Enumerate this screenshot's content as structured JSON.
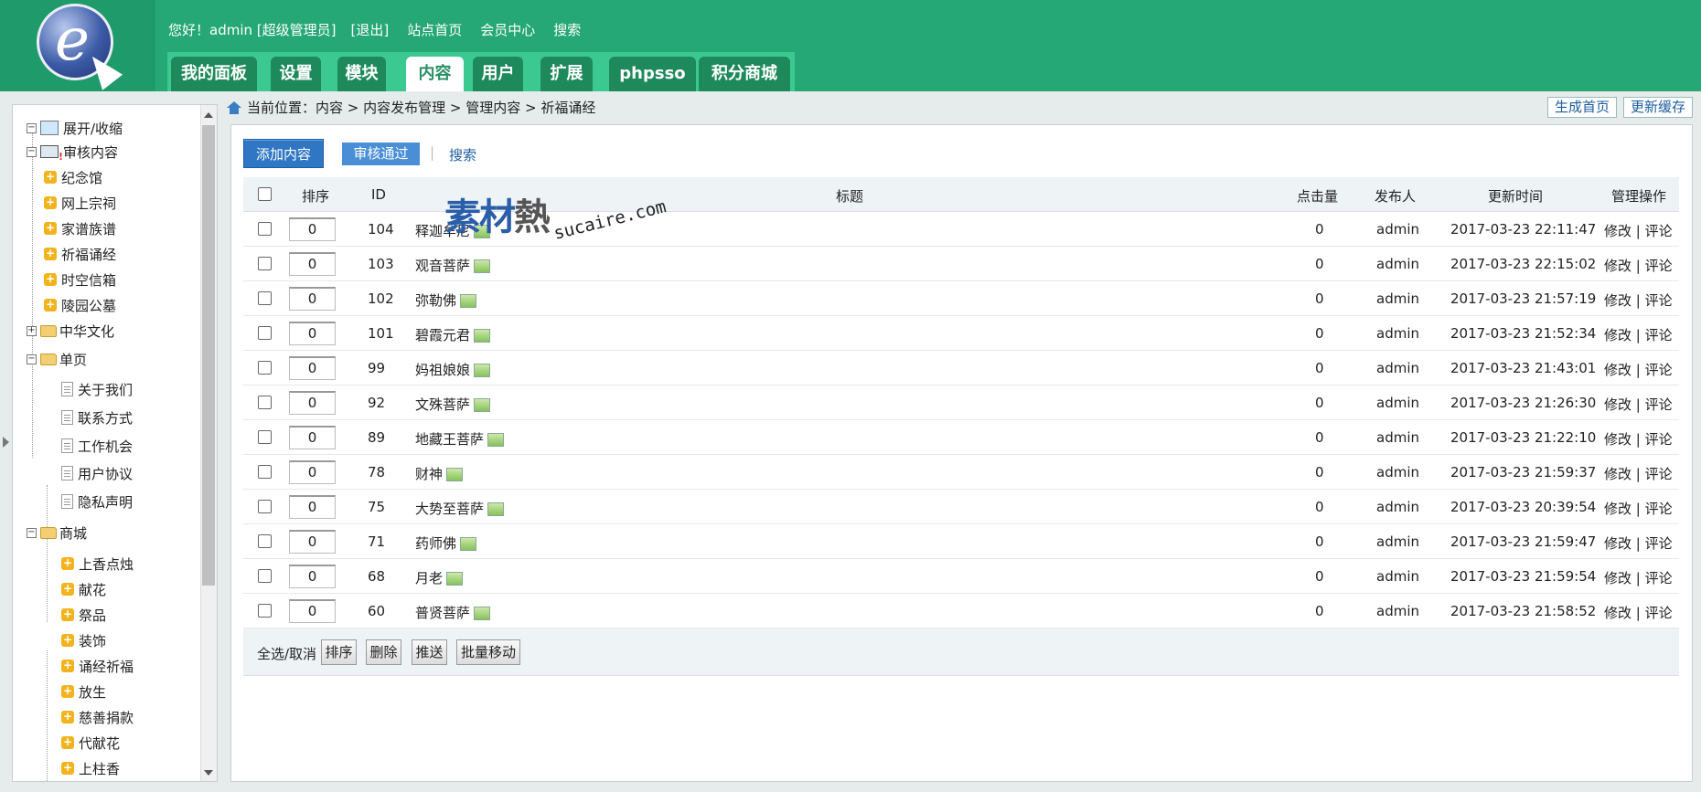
{
  "header": {
    "greeting": "您好！admin [超级管理员]",
    "logout": "[退出]",
    "site_home": "站点首页",
    "member_center": "会员中心",
    "search": "搜索",
    "logo_letter": "e",
    "tabs": [
      {
        "label": "我的面板"
      },
      {
        "label": "设置"
      },
      {
        "label": "模块"
      },
      {
        "label": "内容"
      },
      {
        "label": "用户"
      },
      {
        "label": "扩展"
      },
      {
        "label": "phpsso"
      },
      {
        "label": "积分商城"
      }
    ]
  },
  "sidebar": {
    "expand_collapse": "展开/收缩",
    "audit": "审核内容",
    "audit_children": [
      "纪念馆",
      "网上宗祠",
      "家谱族谱",
      "祈福诵经",
      "时空信箱",
      "陵园公墓"
    ],
    "culture": "中华文化",
    "single_page": "单页",
    "single_children": [
      "关于我们",
      "联系方式",
      "工作机会",
      "用户协议",
      "隐私声明"
    ],
    "mall": "商城",
    "mall_children": [
      "上香点烛",
      "献花",
      "祭品",
      "装饰",
      "诵经祈福",
      "放生",
      "慈善捐款",
      "代献花",
      "上柱香"
    ]
  },
  "breadcrumb": {
    "text": "当前位置：内容 > 内容发布管理 > 管理内容 > 祈福诵经"
  },
  "top_buttons": {
    "generate_home": "生成首页",
    "update_cache": "更新缓存"
  },
  "toolbar": {
    "add": "添加内容",
    "approve": "审核通过",
    "separator": "|",
    "search": "搜索"
  },
  "table": {
    "headers": {
      "order": "排序",
      "id": "ID",
      "title": "标题",
      "hits": "点击量",
      "publisher": "发布人",
      "updated": "更新时间",
      "ops": "管理操作"
    },
    "rows": [
      {
        "order": "0",
        "id": "104",
        "title": "释迦牟尼",
        "hits": "0",
        "publisher": "admin",
        "updated": "2017-03-23 22:11:47",
        "edit": "修改",
        "comment": "评论"
      },
      {
        "order": "0",
        "id": "103",
        "title": "观音菩萨",
        "hits": "0",
        "publisher": "admin",
        "updated": "2017-03-23 22:15:02",
        "edit": "修改",
        "comment": "评论"
      },
      {
        "order": "0",
        "id": "102",
        "title": "弥勒佛",
        "hits": "0",
        "publisher": "admin",
        "updated": "2017-03-23 21:57:19",
        "edit": "修改",
        "comment": "评论"
      },
      {
        "order": "0",
        "id": "101",
        "title": "碧霞元君",
        "hits": "0",
        "publisher": "admin",
        "updated": "2017-03-23 21:52:34",
        "edit": "修改",
        "comment": "评论"
      },
      {
        "order": "0",
        "id": "99",
        "title": "妈祖娘娘",
        "hits": "0",
        "publisher": "admin",
        "updated": "2017-03-23 21:43:01",
        "edit": "修改",
        "comment": "评论"
      },
      {
        "order": "0",
        "id": "92",
        "title": "文殊菩萨",
        "hits": "0",
        "publisher": "admin",
        "updated": "2017-03-23 21:26:30",
        "edit": "修改",
        "comment": "评论"
      },
      {
        "order": "0",
        "id": "89",
        "title": "地藏王菩萨",
        "hits": "0",
        "publisher": "admin",
        "updated": "2017-03-23 21:22:10",
        "edit": "修改",
        "comment": "评论"
      },
      {
        "order": "0",
        "id": "78",
        "title": "财神",
        "hits": "0",
        "publisher": "admin",
        "updated": "2017-03-23 21:59:37",
        "edit": "修改",
        "comment": "评论"
      },
      {
        "order": "0",
        "id": "75",
        "title": "大势至菩萨",
        "hits": "0",
        "publisher": "admin",
        "updated": "2017-03-23 20:39:54",
        "edit": "修改",
        "comment": "评论"
      },
      {
        "order": "0",
        "id": "71",
        "title": "药师佛",
        "hits": "0",
        "publisher": "admin",
        "updated": "2017-03-23 21:59:47",
        "edit": "修改",
        "comment": "评论"
      },
      {
        "order": "0",
        "id": "68",
        "title": "月老",
        "hits": "0",
        "publisher": "admin",
        "updated": "2017-03-23 21:59:54",
        "edit": "修改",
        "comment": "评论"
      },
      {
        "order": "0",
        "id": "60",
        "title": "普贤菩萨",
        "hits": "0",
        "publisher": "admin",
        "updated": "2017-03-23 21:58:52",
        "edit": "修改",
        "comment": "评论"
      }
    ],
    "op_separator": "|"
  },
  "footer": {
    "select_all": "全选/取消",
    "sort": "排序",
    "delete": "删除",
    "push": "推送",
    "batch_move": "批量移动"
  },
  "watermark": {
    "main_blue": "素材",
    "main_gray": "熱",
    "sub": "sucaire.com"
  }
}
